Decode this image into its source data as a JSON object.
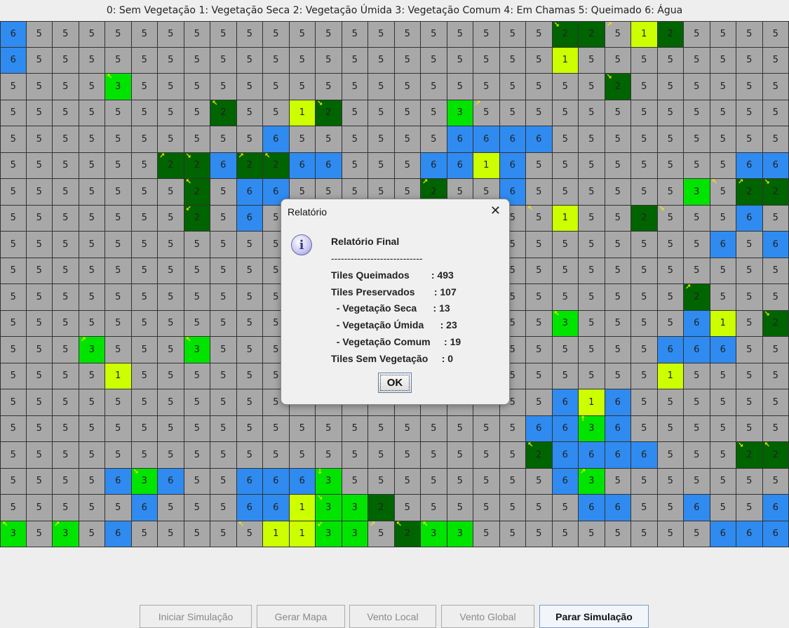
{
  "legend": "0: Sem Vegetação 1: Vegetação Seca 2: Vegetação Úmida 3: Vegetação Comum 4: Em Chamas 5: Queimado 6: Água",
  "colors": {
    "1": "#ccff00",
    "2": "#006400",
    "3": "#00e400",
    "5": "#a8a8a8",
    "6": "#2f8bf0",
    "arrow": "#f0e800"
  },
  "grid": {
    "rows": [
      "655555555555555555555225125555",
      "655555555555555555555155555555",
      "555535555555555555555552555555",
      "555555552551255553555555555555",
      "555555555565555556666555555555",
      "555555226226655566165555555566",
      "555555525665555525565555553522",
      "555555525655555555555155255565",
      "555555555555555555555555555656",
      "555555555555555555555555555555",
      "555555555555555555555555552555",
      "555555555555555555555355556152",
      "555355535555555555555555566655",
      "555515555555555555555555515555",
      "555555555555555555555616555555",
      "555555555555555555556636555555",
      "555555555555555555552666655522",
      "555563655666355555555635555555",
      "555556555661332555555566556556",
      "353565555511335233555555555666"
    ],
    "arrows": {
      "0,21": "↘",
      "0,23": "↗",
      "0,24": "↖",
      "2,4": "↖",
      "2,23": "↘",
      "3,8": "↖",
      "3,12": "↘",
      "3,18": "↗",
      "5,6": "↗",
      "5,7": "↘",
      "5,9": "↗",
      "5,10": "↖",
      "5,18": "↘",
      "6,7": "↖",
      "6,16": "↗",
      "6,27": "↖",
      "6,28": "↗",
      "6,29": "↘",
      "7,7": "↙",
      "7,20": "↖",
      "7,25": "↘",
      "10,26": "↗",
      "11,21": "↖",
      "11,29": "↘",
      "12,3": "↗",
      "12,7": "↖",
      "13,4": "↗",
      "13,25": "↗",
      "14,22": "↗",
      "15,22": "↑",
      "16,20": "↖",
      "16,28": "↘",
      "16,29": "↖",
      "17,5": "↘",
      "17,12": "↓",
      "17,22": "↗",
      "18,11": "↘",
      "18,12": "↘",
      "19,0": "↖",
      "19,2": "↗",
      "19,9": "↖",
      "19,10": "↑",
      "19,11": "↘",
      "19,12": "↙",
      "19,14": "↗",
      "19,15": "↖",
      "19,16": "↖"
    }
  },
  "dialog": {
    "title": "Relatório",
    "heading": "Relatório Final",
    "separator": "----------------------------",
    "lines": [
      "Tiles Queimados        : 493",
      "Tiles Preservados       : 107",
      "  - Vegetação Seca      : 13",
      "  - Vegetação Úmida      : 23",
      "  - Vegetação Comum     : 19",
      "Tiles Sem Vegetação     : 0"
    ],
    "ok_label": "OK"
  },
  "buttons": [
    {
      "label": "Iniciar Simulação",
      "enabled": false
    },
    {
      "label": "Gerar Mapa",
      "enabled": false
    },
    {
      "label": "Vento Local",
      "enabled": false
    },
    {
      "label": "Vento Global",
      "enabled": false
    },
    {
      "label": "Parar Simulação",
      "enabled": true
    }
  ]
}
